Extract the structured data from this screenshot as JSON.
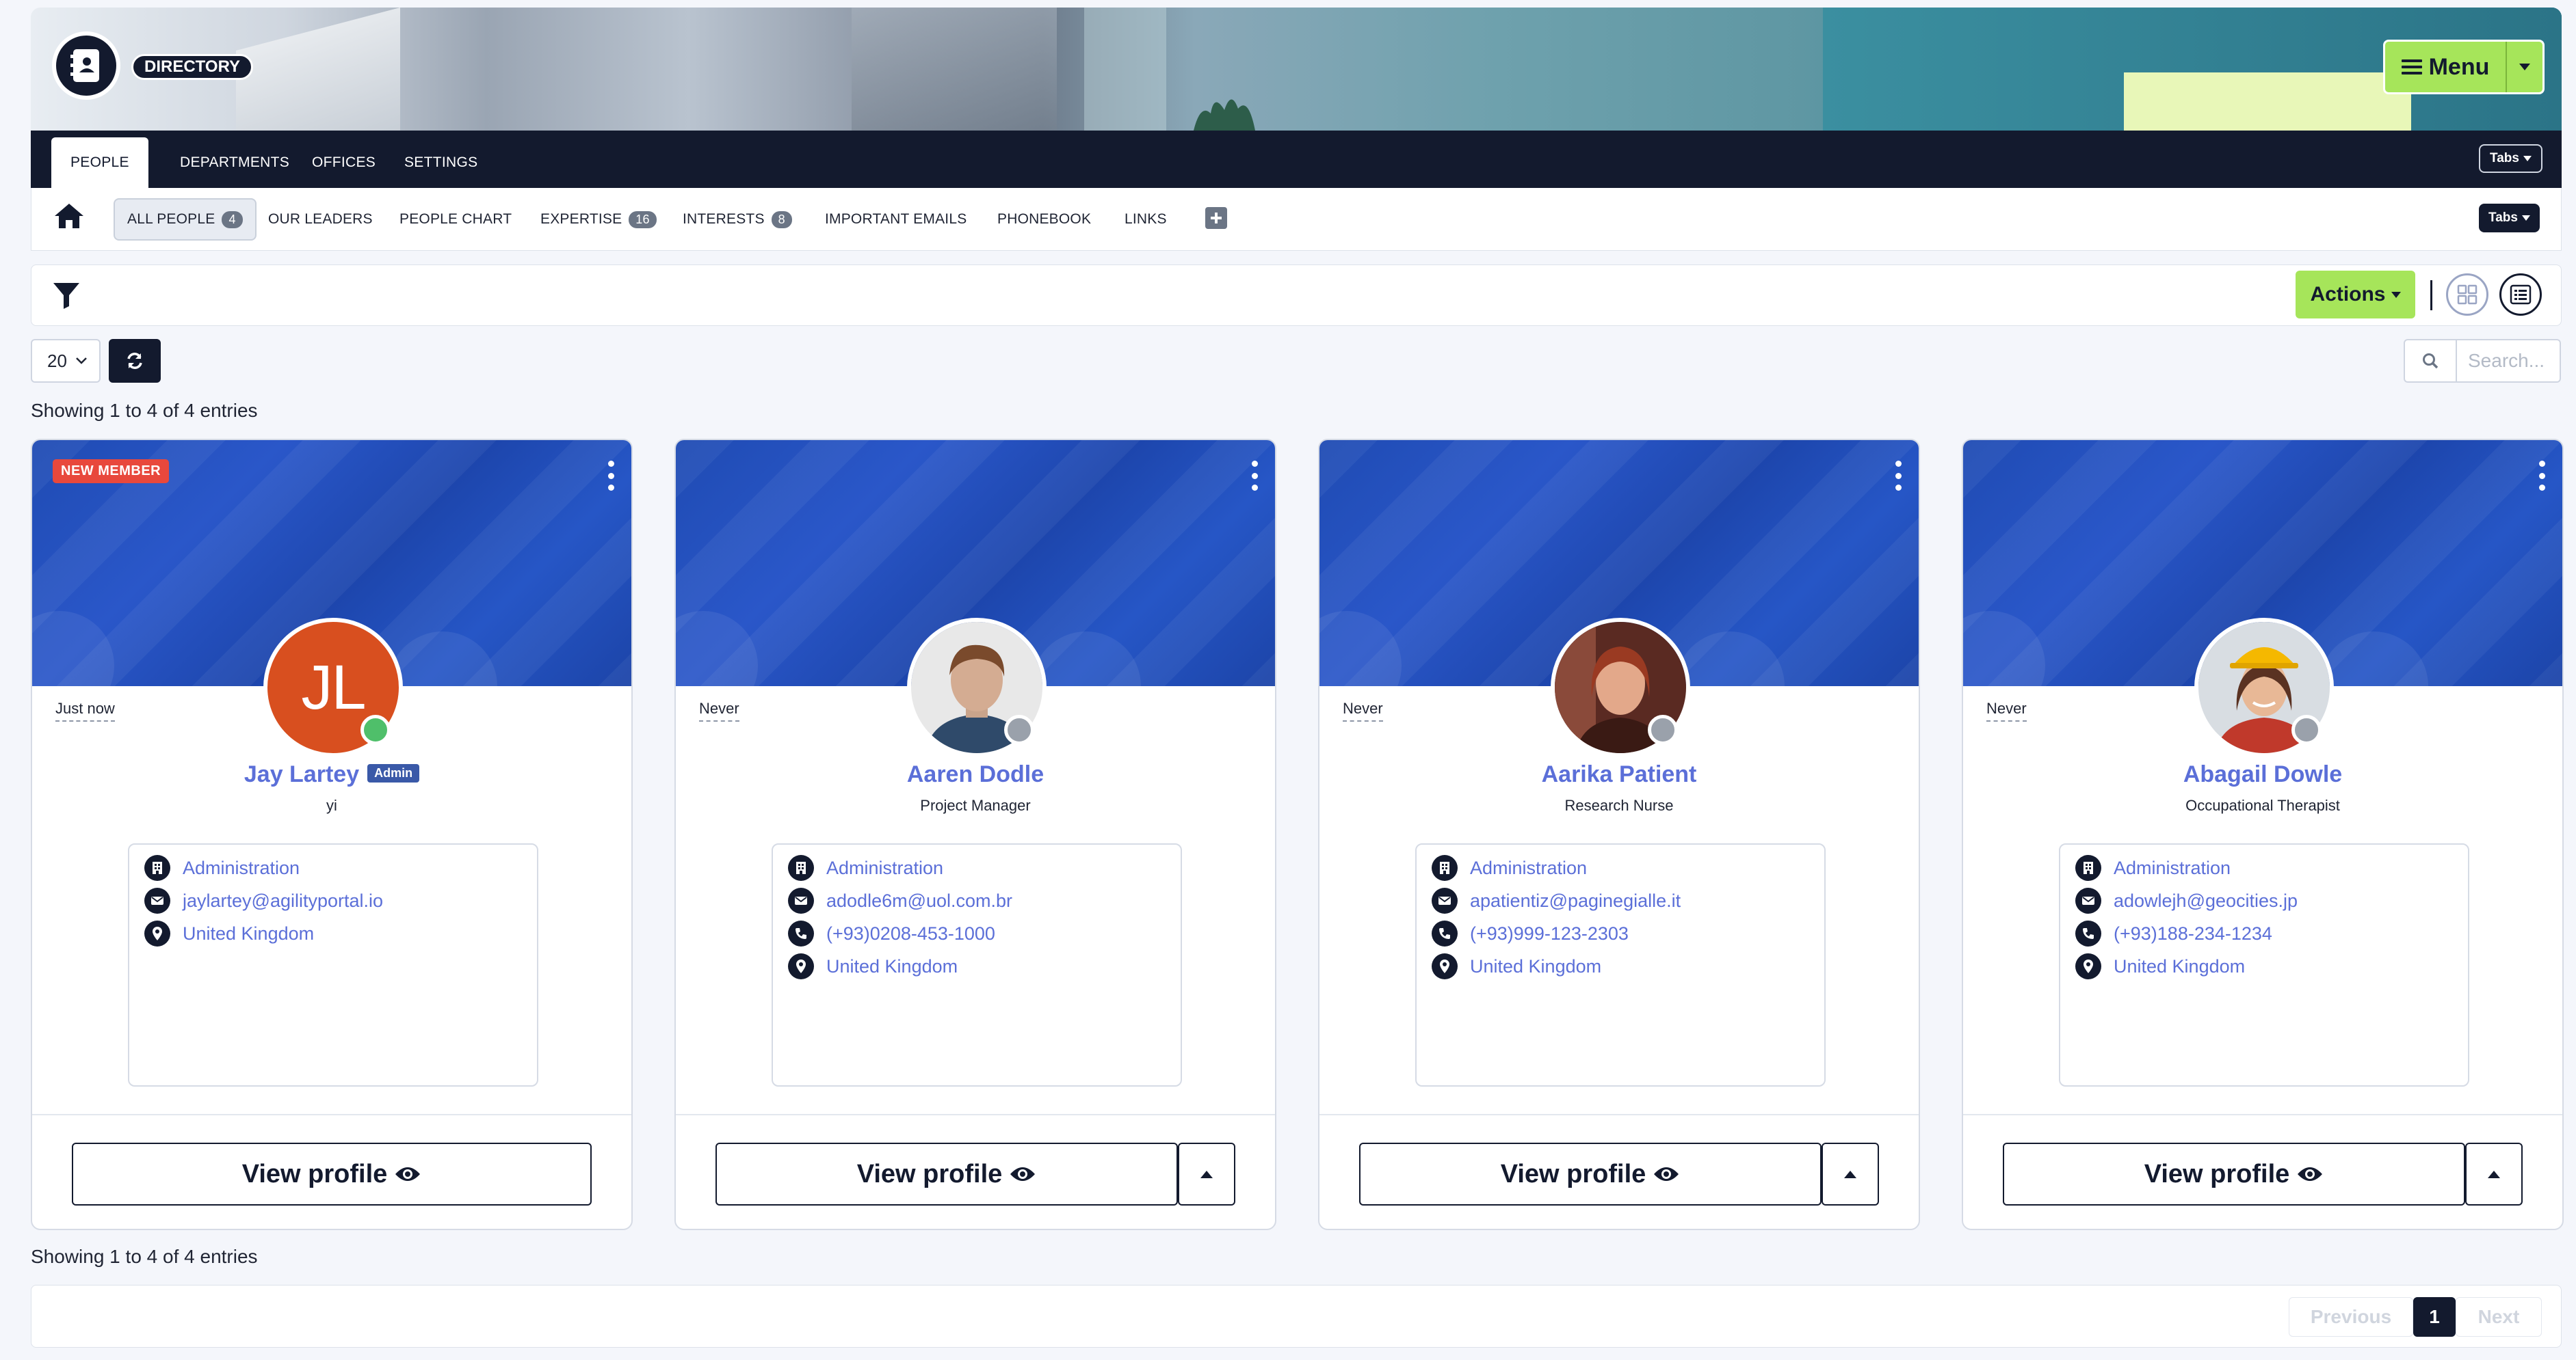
{
  "header": {
    "app_label": "DIRECTORY",
    "menu_label": "Menu"
  },
  "main_tabs": [
    {
      "label": "PEOPLE",
      "active": true
    },
    {
      "label": "DEPARTMENTS"
    },
    {
      "label": "OFFICES"
    },
    {
      "label": "SETTINGS"
    }
  ],
  "tabs_button_label": "Tabs",
  "sub_tabs": [
    {
      "label": "ALL PEOPLE",
      "badge": "4",
      "active": true
    },
    {
      "label": "OUR LEADERS"
    },
    {
      "label": "PEOPLE CHART"
    },
    {
      "label": "EXPERTISE",
      "badge": "16"
    },
    {
      "label": "INTERESTS",
      "badge": "8"
    },
    {
      "label": "IMPORTANT EMAILS"
    },
    {
      "label": "PHONEBOOK"
    },
    {
      "label": "LINKS"
    }
  ],
  "toolbar": {
    "actions_label": "Actions"
  },
  "table_controls": {
    "page_length": "20",
    "search_placeholder": "Search..."
  },
  "entries_info": "Showing 1 to 4 of 4 entries",
  "people": [
    {
      "badge": "NEW MEMBER",
      "last_seen": "Just now",
      "initials": "JL",
      "name": "Jay Lartey",
      "role_badge": "Admin",
      "title": "yi",
      "status_color": "#4fbf6a",
      "details": [
        {
          "icon": "building-icon",
          "text": "Administration"
        },
        {
          "icon": "envelope-icon",
          "text": "jaylartey@agilityportal.io"
        },
        {
          "icon": "location-pin-icon",
          "text": "United Kingdom"
        }
      ],
      "view_label": "View profile"
    },
    {
      "last_seen": "Never",
      "name": "Aaren Dodle",
      "title": "Project Manager",
      "status_color": "#9aa1ab",
      "photo_colors": [
        "#c9a48b",
        "#5a3a2a",
        "#2f4a6a"
      ],
      "details": [
        {
          "icon": "building-icon",
          "text": "Administration"
        },
        {
          "icon": "envelope-icon",
          "text": "adodle6m@uol.com.br"
        },
        {
          "icon": "phone-icon",
          "text": "(+93)0208-453-1000"
        },
        {
          "icon": "location-pin-icon",
          "text": "United Kingdom"
        }
      ],
      "view_label": "View profile"
    },
    {
      "last_seen": "Never",
      "name": "Aarika Patient",
      "title": "Research Nurse",
      "status_color": "#9aa1ab",
      "photo_colors": [
        "#e0a286",
        "#7a2d1e",
        "#a84a3a"
      ],
      "details": [
        {
          "icon": "building-icon",
          "text": "Administration"
        },
        {
          "icon": "envelope-icon",
          "text": "apatientiz@paginegialle.it"
        },
        {
          "icon": "phone-icon",
          "text": "(+93)999-123-2303"
        },
        {
          "icon": "location-pin-icon",
          "text": "United Kingdom"
        }
      ],
      "view_label": "View profile"
    },
    {
      "last_seen": "Never",
      "name": "Abagail Dowle",
      "title": "Occupational Therapist",
      "status_color": "#9aa1ab",
      "photo_colors": [
        "#e2b28e",
        "#5a3222",
        "#c0392b"
      ],
      "details": [
        {
          "icon": "building-icon",
          "text": "Administration"
        },
        {
          "icon": "envelope-icon",
          "text": "adowlejh@geocities.jp"
        },
        {
          "icon": "phone-icon",
          "text": "(+93)188-234-1234"
        },
        {
          "icon": "location-pin-icon",
          "text": "United Kingdom"
        }
      ],
      "view_label": "View profile"
    }
  ],
  "pagination": {
    "previous": "Previous",
    "current": "1",
    "next": "Next"
  },
  "colors": {
    "brand_dark": "#131a2e",
    "accent_green": "#a6e55a",
    "link_blue": "#5b6fd8"
  }
}
